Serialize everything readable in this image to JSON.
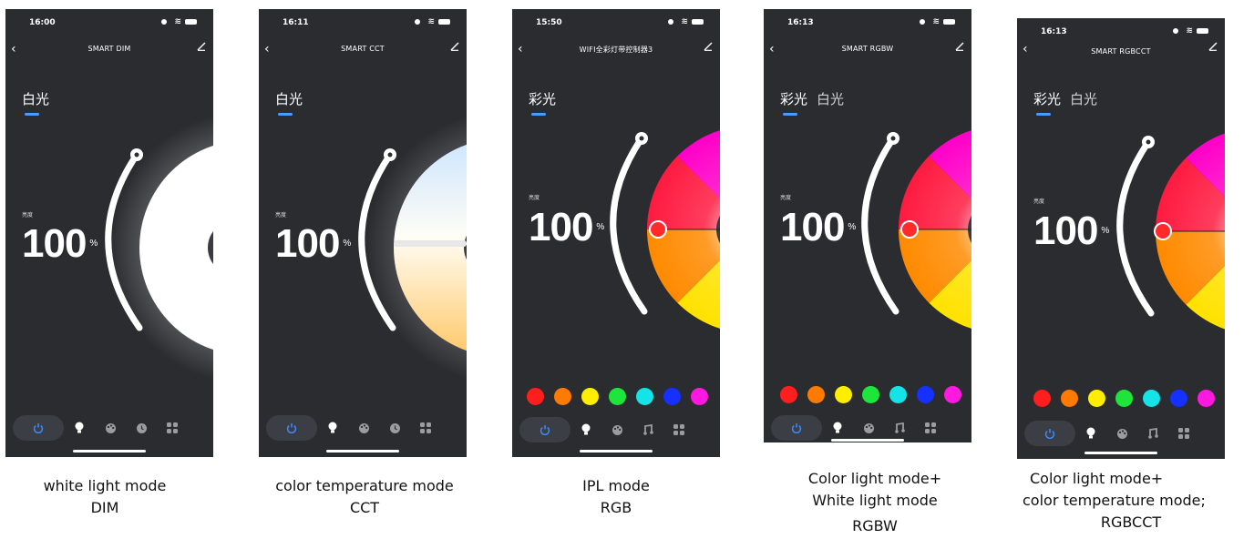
{
  "phones": [
    {
      "id": "dim",
      "time": "16:00",
      "title": "SMART DIM",
      "tabs": [
        "白光"
      ],
      "brightness_label": "亮度",
      "brightness_value": "100",
      "brightness_unit": "%",
      "bottom_icons": [
        "power-icon",
        "bulb-icon",
        "palette-icon",
        "clock-icon",
        "grid-icon"
      ],
      "caption": [
        "white light mode",
        "DIM"
      ]
    },
    {
      "id": "cct",
      "time": "16:11",
      "title": "SMART CCT",
      "tabs": [
        "白光"
      ],
      "brightness_label": "亮度",
      "brightness_value": "100",
      "brightness_unit": "%",
      "bottom_icons": [
        "power-icon",
        "bulb-icon",
        "palette-icon",
        "clock-icon",
        "grid-icon"
      ],
      "caption": [
        "color temperature mode",
        "CCT"
      ]
    },
    {
      "id": "rgb",
      "time": "15:50",
      "title": "WIFI全彩灯带控制器3",
      "tabs": [
        "彩光"
      ],
      "brightness_label": "亮度",
      "brightness_value": "100",
      "brightness_unit": "%",
      "swatches": [
        "#ff1e1e",
        "#ff7a00",
        "#ffee00",
        "#1ee53a",
        "#14e3e8",
        "#1530ff",
        "#ff18e0"
      ],
      "bottom_icons": [
        "power-icon",
        "bulb-icon",
        "palette-icon",
        "music-icon",
        "grid-icon"
      ],
      "caption": [
        "IPL mode",
        "RGB"
      ]
    },
    {
      "id": "rgbw",
      "time": "16:13",
      "title": "SMART RGBW",
      "tabs": [
        "彩光",
        "白光"
      ],
      "brightness_label": "亮度",
      "brightness_value": "100",
      "brightness_unit": "%",
      "swatches": [
        "#ff1e1e",
        "#ff7a00",
        "#ffee00",
        "#1ee53a",
        "#14e3e8",
        "#1530ff",
        "#ff18e0"
      ],
      "bottom_icons": [
        "power-icon",
        "bulb-icon",
        "palette-icon",
        "music-icon",
        "grid-icon"
      ],
      "caption": [
        "Color light mode+",
        "White light mode",
        "RGBW"
      ]
    },
    {
      "id": "rgbcct",
      "time": "16:13",
      "title": "SMART RGBCCT",
      "tabs": [
        "彩光",
        "白光"
      ],
      "brightness_label": "亮度",
      "brightness_value": "100",
      "brightness_unit": "%",
      "swatches": [
        "#ff1e1e",
        "#ff7a00",
        "#ffee00",
        "#1ee53a",
        "#14e3e8",
        "#1530ff",
        "#ff18e0"
      ],
      "bottom_icons": [
        "power-icon",
        "bulb-icon",
        "palette-icon",
        "music-icon",
        "grid-icon"
      ],
      "caption": [
        "Color light mode+",
        " color temperature mode;",
        "RGBCCT"
      ]
    }
  ],
  "colors": {
    "phone_bg": "#2a2c30",
    "accent": "#4a9bff",
    "power_pill": "#3b3e45"
  }
}
